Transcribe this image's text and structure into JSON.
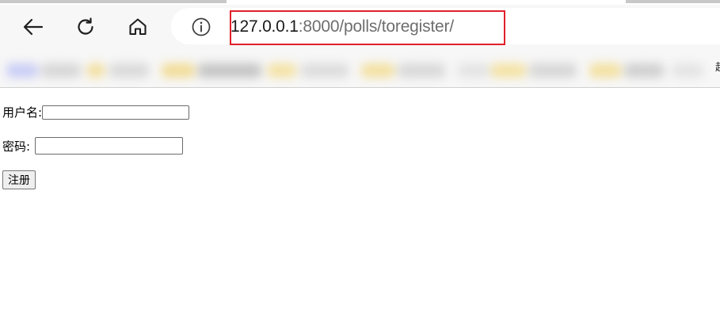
{
  "browser": {
    "url_host": "127.0.0.1",
    "url_rest": ":8000/polls/toregister/",
    "icons": {
      "back": "arrow-left-icon",
      "reload": "reload-icon",
      "home": "home-icon",
      "info": "info-icon"
    },
    "highlight_color": "#e0202a",
    "bookmarks_cut_text": "起"
  },
  "form": {
    "username_label": "用户名:",
    "username_value": "",
    "password_label": "密码:",
    "password_value": "",
    "submit_label": "注册"
  }
}
